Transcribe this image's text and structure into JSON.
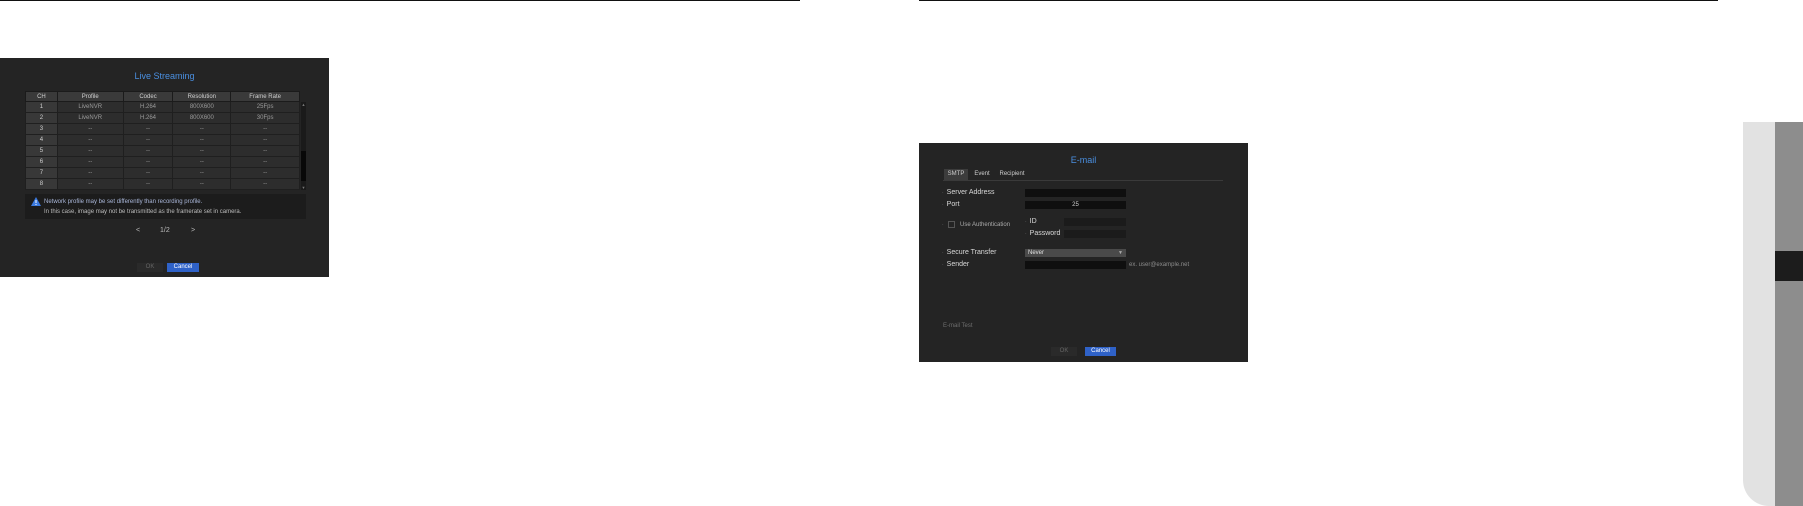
{
  "live_streaming": {
    "title": "Live Streaming",
    "columns": [
      "CH",
      "Profile",
      "Codec",
      "Resolution",
      "Frame Rate"
    ],
    "rows": [
      {
        "ch": "1",
        "profile": "LiveNVR",
        "codec": "H.264",
        "resolution": "800X600",
        "frame_rate": "25Fps"
      },
      {
        "ch": "2",
        "profile": "LiveNVR",
        "codec": "H.264",
        "resolution": "800X600",
        "frame_rate": "30Fps"
      },
      {
        "ch": "3",
        "profile": "--",
        "codec": "--",
        "resolution": "--",
        "frame_rate": "--"
      },
      {
        "ch": "4",
        "profile": "--",
        "codec": "--",
        "resolution": "--",
        "frame_rate": "--"
      },
      {
        "ch": "5",
        "profile": "--",
        "codec": "--",
        "resolution": "--",
        "frame_rate": "--"
      },
      {
        "ch": "6",
        "profile": "--",
        "codec": "--",
        "resolution": "--",
        "frame_rate": "--"
      },
      {
        "ch": "7",
        "profile": "--",
        "codec": "--",
        "resolution": "--",
        "frame_rate": "--"
      },
      {
        "ch": "8",
        "profile": "--",
        "codec": "--",
        "resolution": "--",
        "frame_rate": "--"
      }
    ],
    "notice_line1": "Network profile may be set differently than recording profile.",
    "notice_line2": "In this case, image may not be transmitted as the framerate set in camera.",
    "pager": {
      "current": "1/2",
      "prev": "<",
      "next": ">"
    },
    "ok_label": "OK",
    "cancel_label": "Cancel"
  },
  "email": {
    "title": "E-mail",
    "tabs": [
      "SMTP",
      "Event",
      "Recipient"
    ],
    "active_tab": "SMTP",
    "server_address_label": "Server Address",
    "server_address_value": "",
    "port_label": "Port",
    "port_value": "25",
    "use_auth_label": "Use Authentication",
    "id_label": "ID",
    "id_value": "",
    "password_label": "Password",
    "password_value": "",
    "secure_transfer_label": "Secure Transfer",
    "secure_transfer_value": "Never",
    "sender_label": "Sender",
    "sender_value": "",
    "sender_example": "ex. user@example.net",
    "email_test_label": "E-mail Test",
    "ok_label": "OK",
    "cancel_label": "Cancel"
  },
  "colors": {
    "dialog_bg": "#242424",
    "title_blue": "#4a8fe0",
    "cancel_blue": "#2f62c8"
  }
}
